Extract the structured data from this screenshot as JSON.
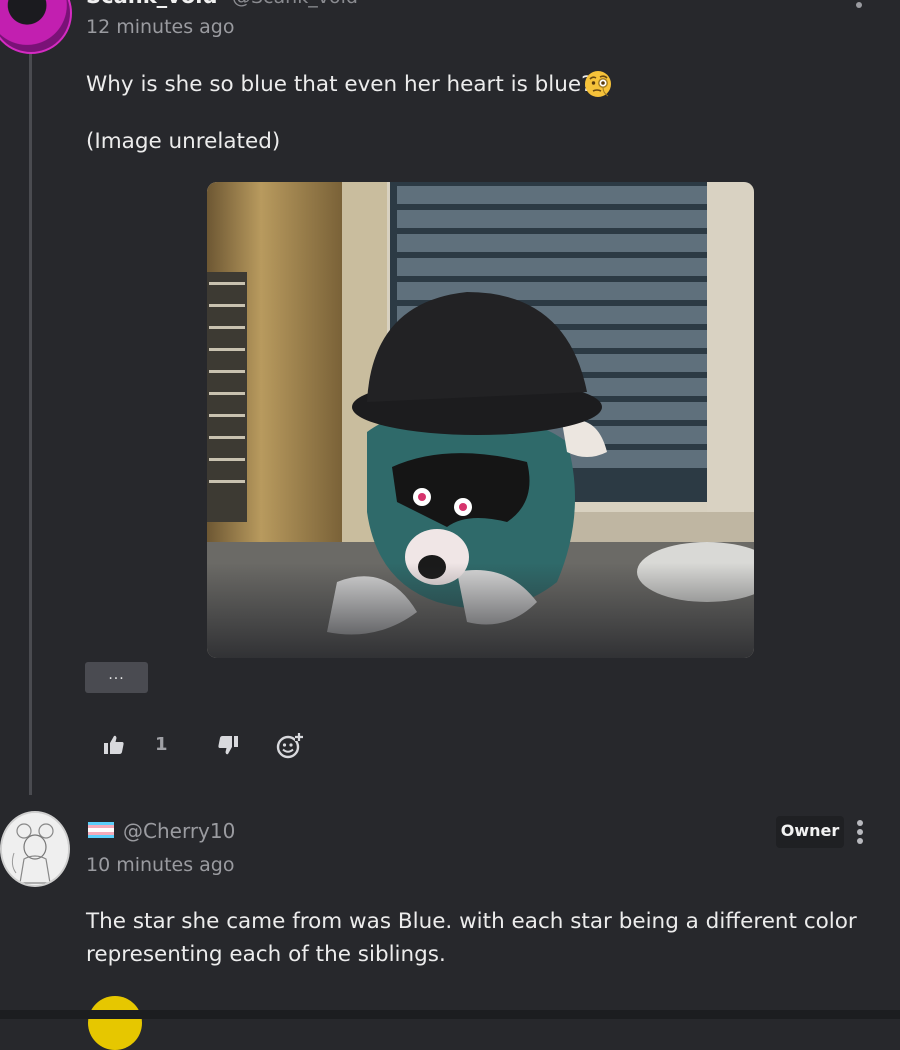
{
  "comment1": {
    "username_cut": "Scank_void",
    "handle_cut": "@Scank_void",
    "time": "12 minutes ago",
    "text": "Why is she so blue that even her heart is blue?",
    "emoji": "face-with-monocle",
    "caption": "(Image unrelated)",
    "more_label": "...",
    "likes": "1"
  },
  "comment2": {
    "handle": "@Cherry10",
    "badge": "Owner",
    "time": "10 minutes ago",
    "text_line1": "The star she came from was Blue. with each star being a different color",
    "text_line2": "representing each of the siblings."
  },
  "icons": {
    "like": "thumbs-up-icon",
    "dislike": "thumbs-down-icon",
    "react": "add-reaction-icon",
    "menu": "kebab-menu-icon"
  },
  "colors": {
    "background": "#27282c",
    "thread_line": "#4a4b50",
    "badge_bg": "#1f2023",
    "flag_blue": "#5bcffa",
    "flag_pink": "#f5abb9",
    "flag_white": "#ffffff"
  }
}
